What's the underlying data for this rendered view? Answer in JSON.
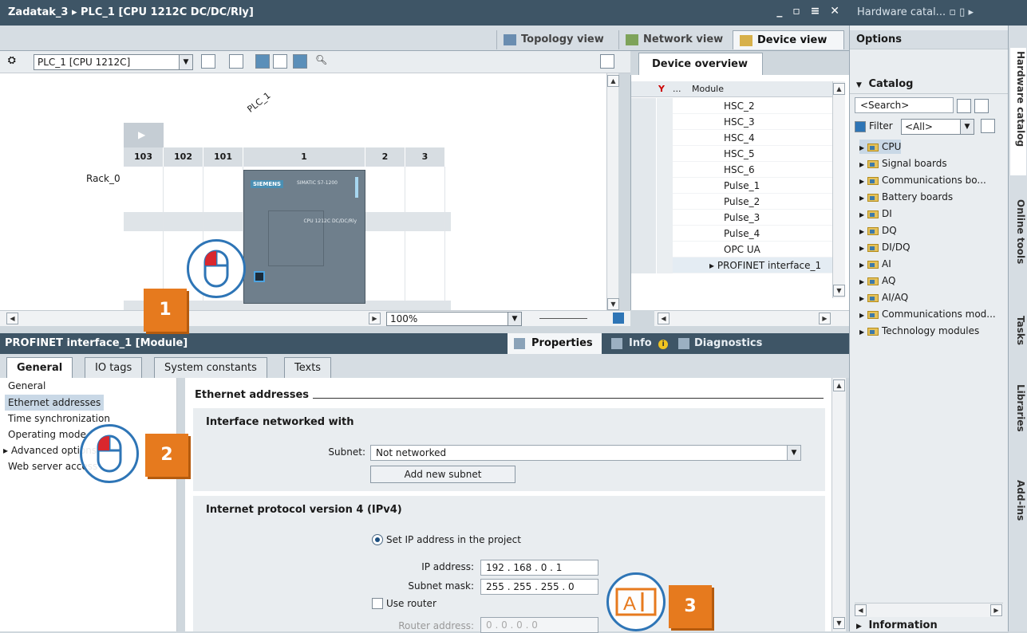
{
  "window": {
    "title": "Zadatak_3 ▸ PLC_1 [CPU 1212C DC/DC/Rly]",
    "controls": "_ ▫ ≡ ✕",
    "catalog_title": "Hardware catal... ▫ ▯ ▸"
  },
  "views": {
    "topology": "Topology view",
    "network": "Network view",
    "device": "Device view"
  },
  "toolbar": {
    "device_select": "PLC_1 [CPU 1212C]",
    "zoom": "100%"
  },
  "canvas": {
    "device_label": "PLC_1",
    "rack_label": "Rack_0",
    "slots": [
      "103",
      "102",
      "101",
      "1",
      "2",
      "3"
    ],
    "plc_logo": "SIEMENS",
    "plc_brand": "SIMATIC S7-1200",
    "plc_info": "CPU 1212C DC/DC/Rly"
  },
  "device_overview": {
    "tab_label": "Device overview",
    "col_dots": "...",
    "col_module": "Module",
    "rows": [
      "HSC_2",
      "HSC_3",
      "HSC_4",
      "HSC_5",
      "HSC_6",
      "Pulse_1",
      "Pulse_2",
      "Pulse_3",
      "Pulse_4",
      "OPC UA",
      "▸ PROFINET interface_1"
    ]
  },
  "properties_bar": {
    "title": "PROFINET interface_1 [Module]",
    "properties": "Properties",
    "info": "Info",
    "diagnostics": "Diagnostics"
  },
  "prop_tabs": [
    "General",
    "IO tags",
    "System constants",
    "Texts"
  ],
  "nav": {
    "items": [
      "General",
      "Ethernet addresses",
      "Time synchronization",
      "Operating mode",
      "▸ Advanced options",
      "Web server access"
    ]
  },
  "ethernet": {
    "heading": "Ethernet addresses",
    "section1_title": "Interface networked with",
    "subnet_label": "Subnet:",
    "subnet_value": "Not networked",
    "add_subnet": "Add new subnet",
    "section2_title": "Internet protocol version 4 (IPv4)",
    "set_ip_label": "Set IP address in the project",
    "ip_label": "IP address:",
    "ip_value": "192 . 168 . 0    . 1",
    "mask_label": "Subnet mask:",
    "mask_value": "255 . 255 . 255 . 0",
    "use_router": "Use router",
    "router_label": "Router address:",
    "router_value": "0    . 0    . 0    . 0"
  },
  "catalog": {
    "options": "Options",
    "catalog": "Catalog",
    "search_placeholder": "<Search>",
    "filter_label": "Filter",
    "filter_value": "<All>",
    "items": [
      "CPU",
      "Signal boards",
      "Communications bo...",
      "Battery boards",
      "DI",
      "DQ",
      "DI/DQ",
      "AI",
      "AQ",
      "AI/AQ",
      "Communications mod...",
      "Technology modules"
    ],
    "information": "Information"
  },
  "side_tabs": [
    "Hardware catalog",
    "Online tools",
    "Tasks",
    "Libraries",
    "Add-ins"
  ],
  "callouts": [
    "1",
    "2",
    "3"
  ],
  "colors": {
    "accent": "#e67a1e",
    "titlebar": "#3e5566",
    "callout_ring": "#2e75b6"
  }
}
